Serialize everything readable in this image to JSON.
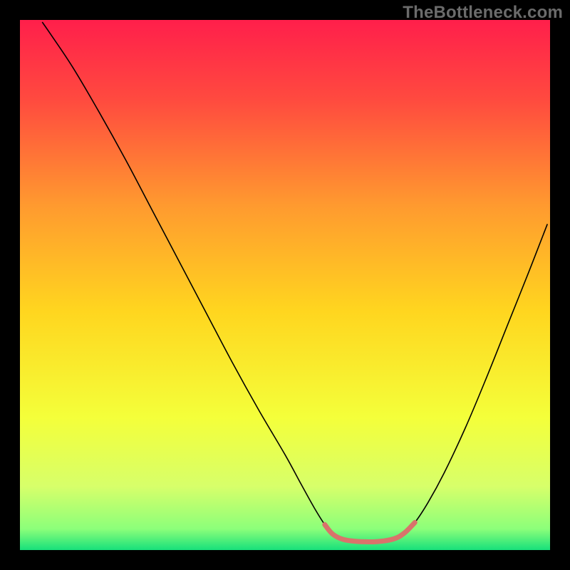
{
  "watermark": {
    "text": "TheBottleneck.com"
  },
  "chart_data": {
    "type": "line",
    "title": "",
    "xlabel": "",
    "ylabel": "",
    "xlim": [
      0,
      100
    ],
    "ylim": [
      0,
      100
    ],
    "background_gradient": {
      "stops": [
        {
          "offset": 0.0,
          "color": "#ff1f4b"
        },
        {
          "offset": 0.15,
          "color": "#ff4a3f"
        },
        {
          "offset": 0.35,
          "color": "#ff9a2f"
        },
        {
          "offset": 0.55,
          "color": "#ffd61f"
        },
        {
          "offset": 0.75,
          "color": "#f4ff3a"
        },
        {
          "offset": 0.88,
          "color": "#d7ff6a"
        },
        {
          "offset": 0.96,
          "color": "#8cff7a"
        },
        {
          "offset": 1.0,
          "color": "#17e07b"
        }
      ]
    },
    "series": [
      {
        "name": "bottleneck-curve",
        "color": "#000000",
        "width": 1.6,
        "points": [
          {
            "x": 4.2,
            "y": 99.6
          },
          {
            "x": 6.0,
            "y": 97.0
          },
          {
            "x": 10.0,
            "y": 91.0
          },
          {
            "x": 15.0,
            "y": 82.5
          },
          {
            "x": 20.0,
            "y": 73.5
          },
          {
            "x": 25.0,
            "y": 64.0
          },
          {
            "x": 30.0,
            "y": 54.5
          },
          {
            "x": 35.0,
            "y": 45.0
          },
          {
            "x": 40.0,
            "y": 35.5
          },
          {
            "x": 45.0,
            "y": 26.5
          },
          {
            "x": 50.0,
            "y": 18.0
          },
          {
            "x": 53.0,
            "y": 12.5
          },
          {
            "x": 55.5,
            "y": 8.0
          },
          {
            "x": 57.5,
            "y": 4.8
          },
          {
            "x": 59.0,
            "y": 3.0
          },
          {
            "x": 61.0,
            "y": 2.0
          },
          {
            "x": 64.0,
            "y": 1.6
          },
          {
            "x": 67.5,
            "y": 1.6
          },
          {
            "x": 70.5,
            "y": 2.1
          },
          {
            "x": 72.5,
            "y": 3.2
          },
          {
            "x": 74.5,
            "y": 5.2
          },
          {
            "x": 77.0,
            "y": 9.0
          },
          {
            "x": 80.0,
            "y": 14.5
          },
          {
            "x": 84.0,
            "y": 23.0
          },
          {
            "x": 88.0,
            "y": 32.5
          },
          {
            "x": 92.0,
            "y": 42.5
          },
          {
            "x": 96.0,
            "y": 52.5
          },
          {
            "x": 99.5,
            "y": 61.5
          }
        ]
      },
      {
        "name": "highlight-band",
        "color": "#d9736b",
        "width": 7,
        "linecap": "round",
        "points": [
          {
            "x": 57.5,
            "y": 4.8
          },
          {
            "x": 59.0,
            "y": 3.0
          },
          {
            "x": 61.0,
            "y": 2.0
          },
          {
            "x": 64.0,
            "y": 1.6
          },
          {
            "x": 67.5,
            "y": 1.6
          },
          {
            "x": 70.5,
            "y": 2.1
          },
          {
            "x": 72.5,
            "y": 3.2
          },
          {
            "x": 74.5,
            "y": 5.2
          }
        ]
      }
    ]
  }
}
